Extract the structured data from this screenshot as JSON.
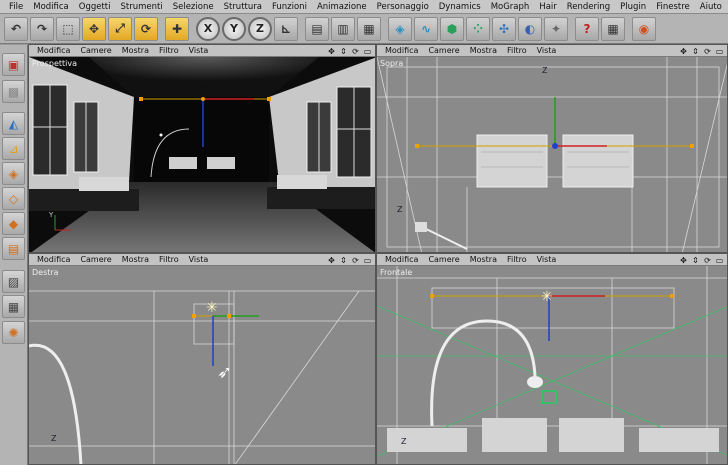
{
  "menu": [
    "File",
    "Modifica",
    "Oggetti",
    "Strumenti",
    "Selezione",
    "Struttura",
    "Funzioni",
    "Animazione",
    "Personaggio",
    "Dynamics",
    "MoGraph",
    "Hair",
    "Rendering",
    "Plugin",
    "Finestre",
    "Aiuto"
  ],
  "toolbar": {
    "undo_icon": "↶",
    "redo_icon": "↷",
    "select_icon": "⬚",
    "move_icon": "✥",
    "scale_icon": "⤢",
    "rotate_icon": "⟳",
    "move2_icon": "✚",
    "x_label": "X",
    "y_label": "Y",
    "z_label": "Z",
    "coord_icon": "⊾",
    "render_region_icon": "▤",
    "render_view_icon": "▥",
    "render_icon": "▦",
    "cube_icon": "◈",
    "spline_icon": "∿",
    "nurbs_icon": "⬢",
    "array_icon": "⁘",
    "deformer_icon": "✣",
    "scene_icon": "◐",
    "light_icon": "✦",
    "help_icon": "?",
    "layout_icon": "▦",
    "world_icon": "◉"
  },
  "leftbar": {
    "view_icon": "▣",
    "checker_icon": "▩",
    "model_icon": "◭",
    "axis_icon": "⊿",
    "points_icon": "◈",
    "edges_icon": "◇",
    "polys_icon": "◆",
    "uvw_icon": "▤",
    "texture_icon": "▨",
    "checker2_icon": "▦",
    "sculpt_icon": "✺"
  },
  "viewports": {
    "menu": [
      "Modifica",
      "Camere",
      "Mostra",
      "Filtro",
      "Vista"
    ],
    "controls": [
      "✥",
      "⇕",
      "⟳",
      "▭"
    ],
    "top_left_label": "Prospettiva",
    "top_right_label": "Sopra",
    "bottom_left_label": "Destra",
    "bottom_right_label": "Frontale"
  }
}
